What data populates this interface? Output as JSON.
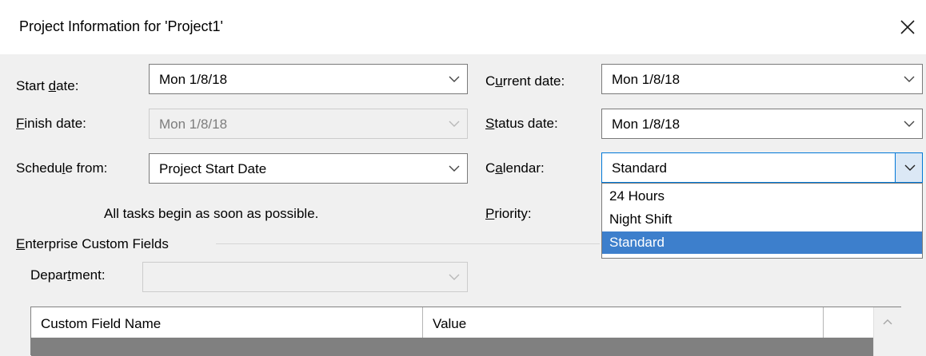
{
  "dialog": {
    "title": "Project Information for 'Project1'"
  },
  "fields": {
    "start_date": {
      "label_pre": "Start ",
      "label_key": "d",
      "label_post": "ate:",
      "value": "Mon 1/8/18"
    },
    "finish_date": {
      "label_pre": "",
      "label_key": "F",
      "label_post": "inish date:",
      "value": "Mon 1/8/18"
    },
    "schedule_from": {
      "label_pre": "Schedu",
      "label_key": "l",
      "label_post": "e from:",
      "value": "Project Start Date"
    },
    "current_date": {
      "label_pre": "C",
      "label_key": "u",
      "label_post": "rrent date:",
      "value": "Mon 1/8/18"
    },
    "status_date": {
      "label_pre": "",
      "label_key": "S",
      "label_post": "tatus date:",
      "value": "Mon 1/8/18"
    },
    "calendar": {
      "label_pre": "C",
      "label_key": "a",
      "label_post": "lendar:",
      "value": "Standard"
    },
    "priority": {
      "label_pre": "",
      "label_key": "P",
      "label_post": "riority:"
    }
  },
  "schedule_note": "All tasks begin as soon as possible.",
  "calendar_options": [
    "24 Hours",
    "Night Shift",
    "Standard"
  ],
  "calendar_selected_index": 2,
  "enterprise": {
    "group_pre": "",
    "group_key": "E",
    "group_post": "nterprise Custom Fields",
    "department": {
      "label_pre": "Depar",
      "label_key": "t",
      "label_post": "ment:",
      "value": ""
    }
  },
  "table": {
    "columns": [
      "Custom Field Name",
      "Value"
    ]
  },
  "icons": {
    "close": "close-icon",
    "dropdown": "chevron-down-icon",
    "scroll_up": "chevron-up-icon"
  }
}
